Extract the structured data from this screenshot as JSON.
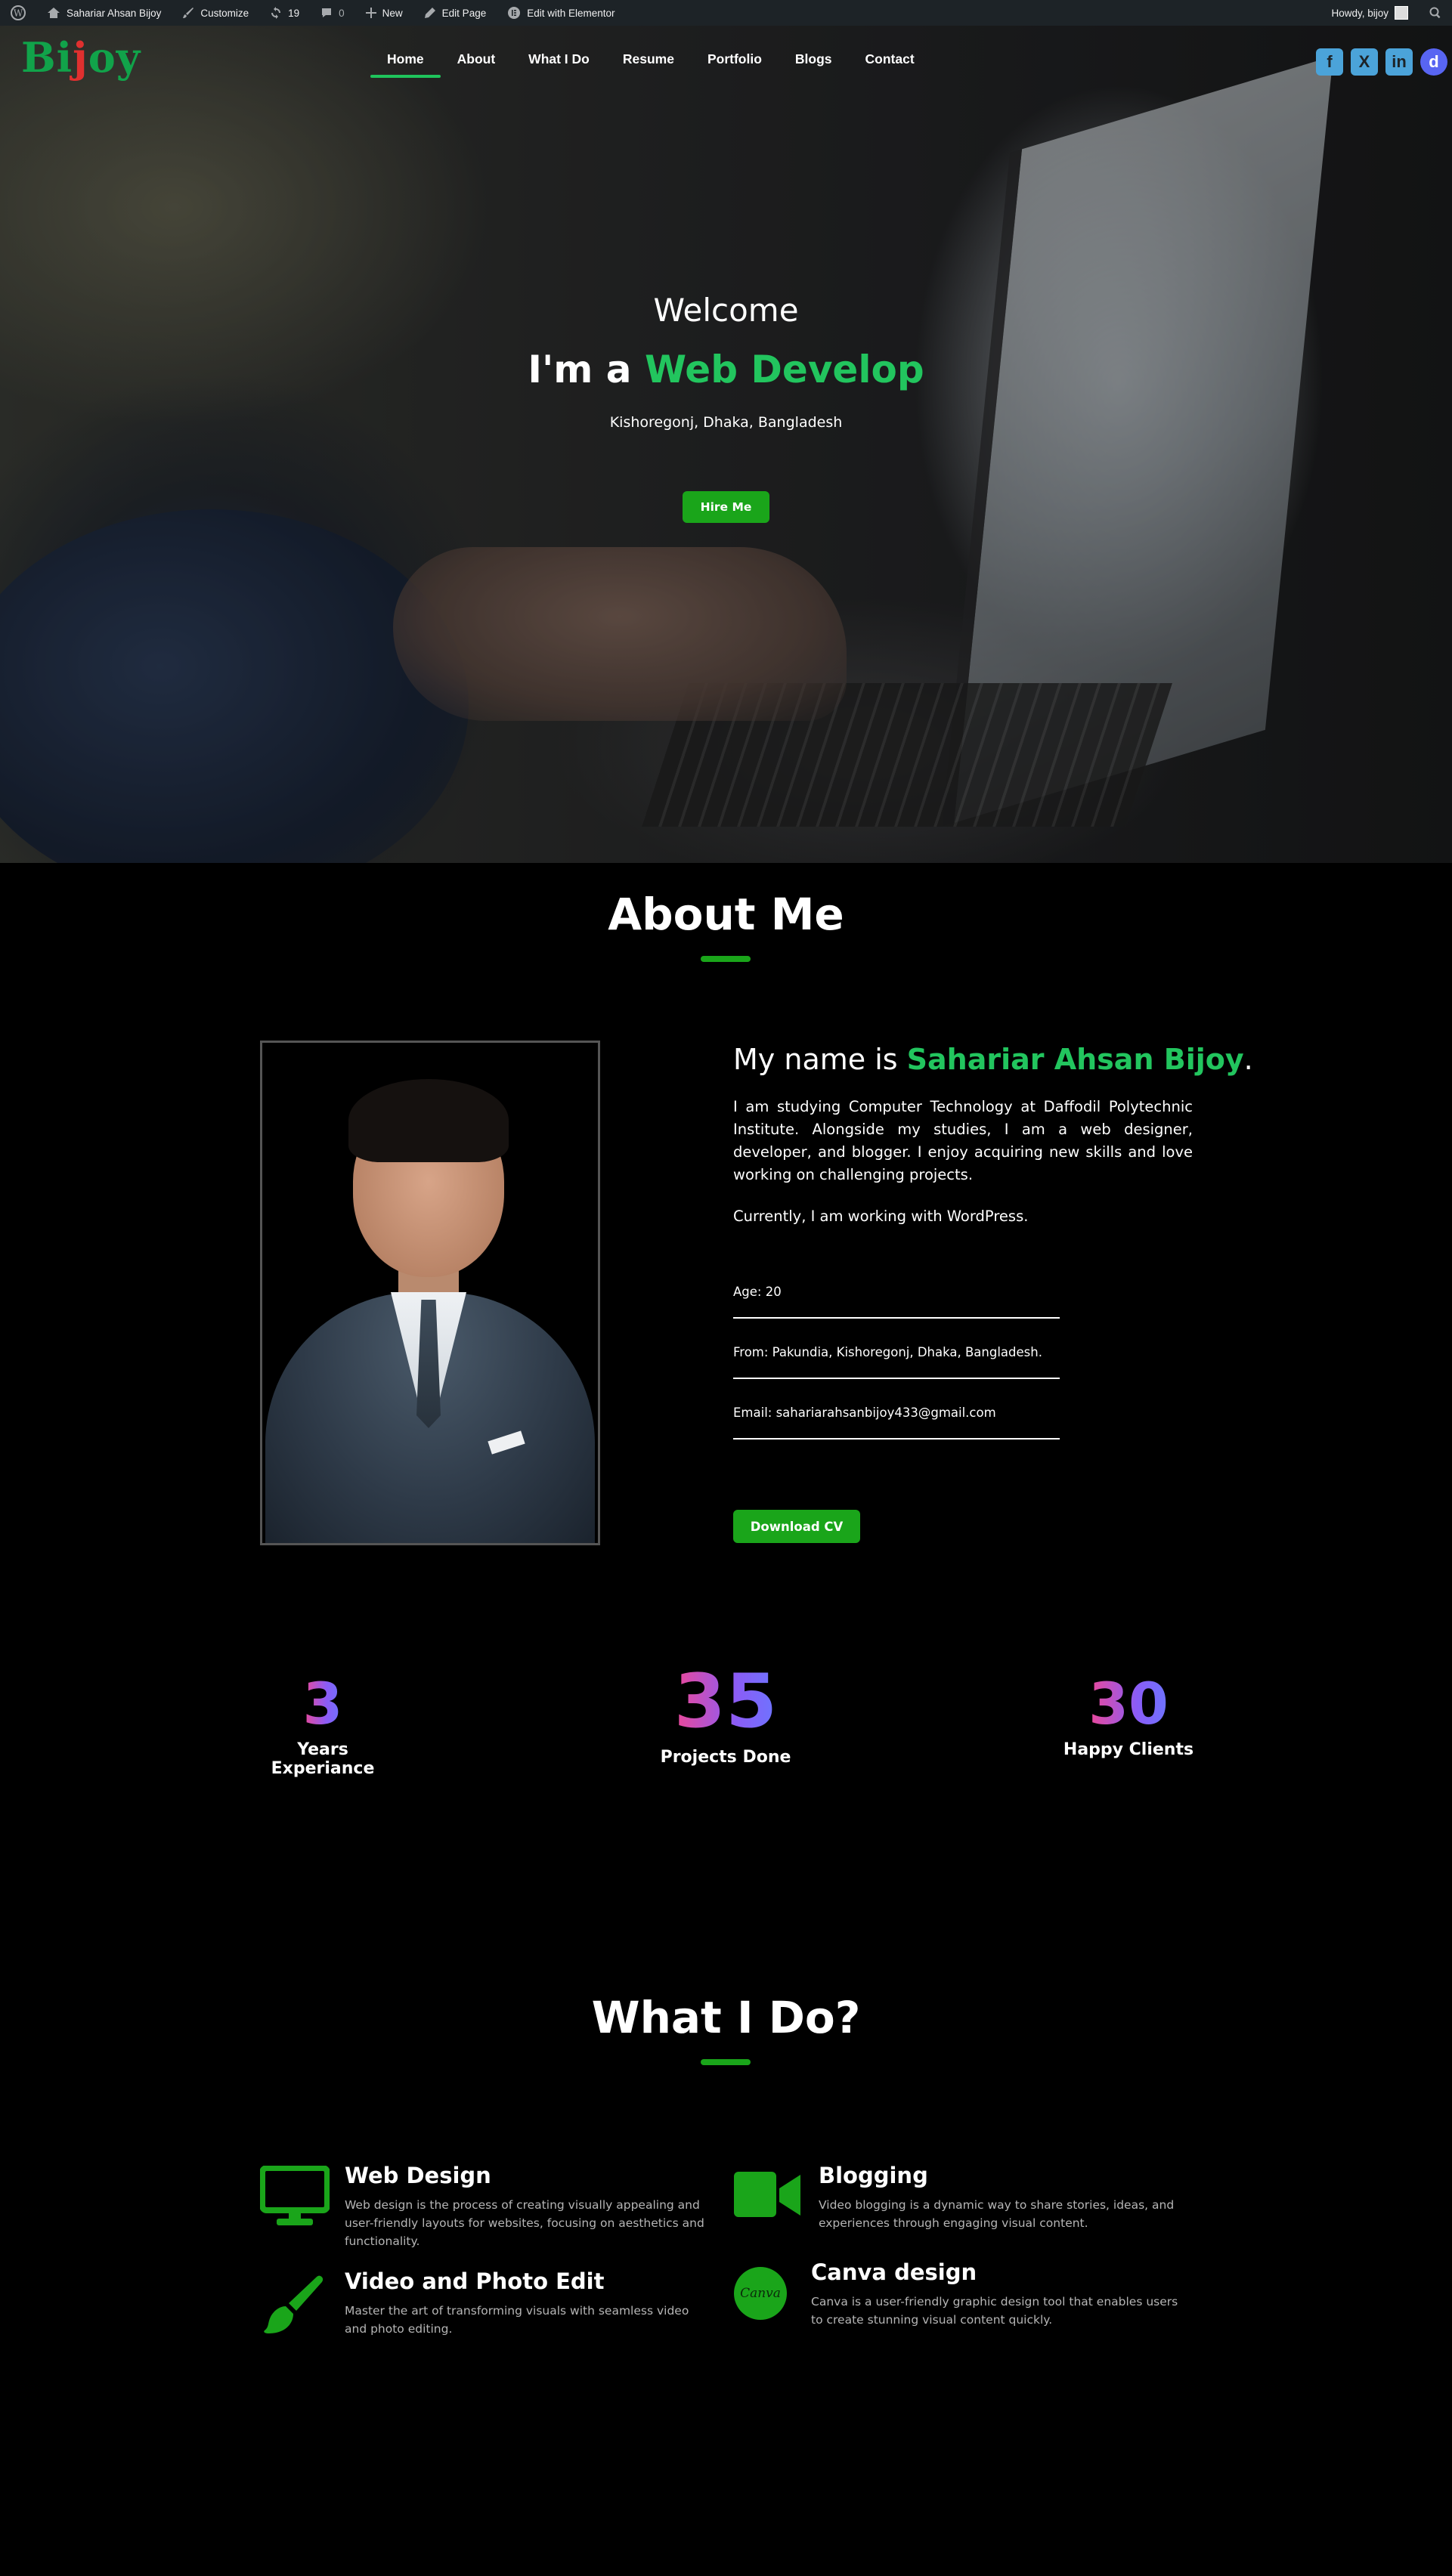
{
  "adminbar": {
    "site_name": "Sahariar Ahsan Bijoy",
    "customize": "Customize",
    "updates_count": "19",
    "comments_count": "0",
    "new": "New",
    "edit_page": "Edit Page",
    "edit_elementor": "Edit with Elementor",
    "howdy": "Howdy, bijoy"
  },
  "logo": {
    "part1": "Bi",
    "part2": "j",
    "part3": "oy"
  },
  "nav": [
    "Home",
    "About",
    "What I Do",
    "Resume",
    "Portfolio",
    "Blogs",
    "Contact"
  ],
  "social": [
    "f",
    "X",
    "in",
    "d"
  ],
  "social_colors": [
    "#4ba3d9",
    "#4ba3d9",
    "#4ba3d9",
    "#5865f2"
  ],
  "hero": {
    "welcome": "Welcome",
    "iam_prefix": "I'm a ",
    "iam_highlight": "Web Develop",
    "location": "Kishoregonj, Dhaka, Bangladesh",
    "hire_button": "Hire Me"
  },
  "about": {
    "title": "About Me",
    "heading_prefix": "My name is ",
    "heading_name": "Sahariar Ahsan Bijoy",
    "heading_suffix": ".",
    "paragraph1": "I am studying Computer Technology at Daffodil Polytechnic Institute. Alongside my studies, I am a web designer, developer, and blogger. I enjoy acquiring new skills and love working on challenging projects.",
    "paragraph2": "Currently, I am working with WordPress.",
    "age": "Age: 20",
    "from": "From: Pakundia, Kishoregonj, Dhaka, Bangladesh.",
    "email": "Email: sahariarahsanbijoy433@gmail.com",
    "cv_button": "Download CV"
  },
  "stats": [
    {
      "value": "3",
      "label": "Years Experiance"
    },
    {
      "value": "35",
      "label": "Projects Done"
    },
    {
      "value": "30",
      "label": "Happy Clients"
    }
  ],
  "services": {
    "title": "What I Do?",
    "items": [
      {
        "title": "Web Design",
        "desc": "Web design is the process of creating visually appealing and user-friendly layouts for websites, focusing on aesthetics and functionality.",
        "icon": "monitor-icon"
      },
      {
        "title": "Blogging",
        "desc": "Video blogging is a dynamic way to share stories, ideas, and experiences through engaging visual content.",
        "icon": "video-camera-icon"
      },
      {
        "title": "Video and Photo Edit",
        "desc": "Master the art of transforming visuals with seamless video and photo editing.",
        "icon": "paint-brush-icon"
      },
      {
        "title": "Canva design",
        "desc": "Canva is a user-friendly graphic design tool that enables users to create stunning visual content quickly.",
        "icon": "canva-icon",
        "icon_text": "Canva"
      }
    ]
  },
  "colors": {
    "accent": "#1aa51a",
    "highlight": "#22c55e",
    "adminbar": "#1d2327"
  }
}
